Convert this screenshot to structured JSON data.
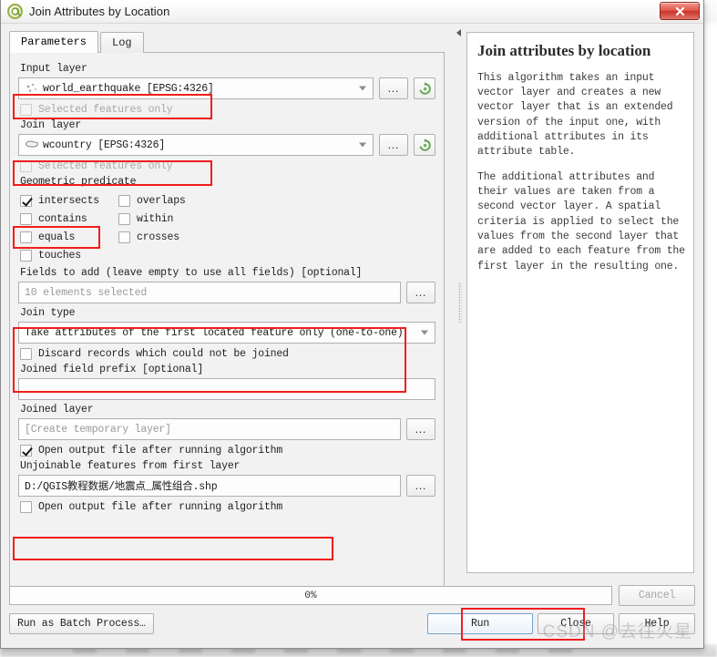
{
  "window": {
    "title": "Join Attributes by Location",
    "icon": "qgis-logo-icon",
    "close_label": "✕"
  },
  "tabs": [
    {
      "id": "parameters",
      "label": "Parameters",
      "active": true
    },
    {
      "id": "log",
      "label": "Log",
      "active": false
    }
  ],
  "form": {
    "input_layer": {
      "label": "Input layer",
      "value": "world_earthquake [EPSG:4326]",
      "icon": "point-layer-icon",
      "dots_label": "…",
      "iterate_icon": "iterate-over-features-icon",
      "highlighted": true
    },
    "input_selected_only": {
      "label": "Selected features only",
      "checked": false,
      "disabled": true
    },
    "join_layer": {
      "label": "Join layer",
      "value": "wcountry [EPSG:4326]",
      "icon": "polygon-layer-icon",
      "dots_label": "…",
      "iterate_icon": "iterate-over-features-icon",
      "highlighted": true
    },
    "join_selected_only": {
      "label": "Selected features only",
      "checked": false,
      "disabled": true
    },
    "geometric_predicate": {
      "label": "Geometric predicate",
      "options": [
        {
          "id": "intersects",
          "label": "intersects",
          "checked": true,
          "highlighted": true
        },
        {
          "id": "overlaps",
          "label": "overlaps",
          "checked": false,
          "highlighted": false
        },
        {
          "id": "contains",
          "label": "contains",
          "checked": false,
          "highlighted": false
        },
        {
          "id": "within",
          "label": "within",
          "checked": false,
          "highlighted": false
        },
        {
          "id": "equals",
          "label": "equals",
          "checked": false,
          "highlighted": false
        },
        {
          "id": "crosses",
          "label": "crosses",
          "checked": false,
          "highlighted": false
        },
        {
          "id": "touches",
          "label": "touches",
          "checked": false,
          "highlighted": false
        }
      ]
    },
    "fields_to_add": {
      "label": "Fields to add (leave empty to use all fields) [optional]",
      "value": "10 elements selected",
      "is_placeholder": true,
      "dots_label": "…"
    },
    "join_type": {
      "label": "Join type",
      "value": "Take attributes of the first located feature only (one-to-one)"
    },
    "discard_records": {
      "label": "Discard records which could not be joined",
      "checked": false
    },
    "joined_field_prefix": {
      "label": "Joined field prefix [optional]",
      "value": ""
    },
    "joined_layer": {
      "label": "Joined layer",
      "value": "[Create temporary layer]",
      "is_placeholder": true,
      "dots_label": "…"
    },
    "open_output_1": {
      "label": "Open output file after running algorithm",
      "checked": true
    },
    "unjoinable_features": {
      "label": "Unjoinable features from first layer",
      "value": "D:/QGIS教程数据/地震点_属性组合.shp",
      "dots_label": "…",
      "highlighted": true
    },
    "open_output_2": {
      "label": "Open output file after running algorithm",
      "checked": false
    }
  },
  "help": {
    "title": "Join attributes by location",
    "paragraphs": [
      "This algorithm takes an input vector layer and creates a new vector layer that is an extended version of the input one, with additional attributes in its attribute table.",
      "The additional attributes and their values are taken from a second vector layer. A spatial criteria is applied to select the values from the second layer that are added to each feature from the first layer in the resulting one."
    ]
  },
  "footer": {
    "progress_text": "0%",
    "progress_value": 0,
    "cancel_label": "Cancel",
    "batch_label": "Run as Batch Process…",
    "run_label": "Run",
    "close_label": "Close",
    "help_label": "Help",
    "run_highlighted": true
  },
  "watermark": "CSDN @去往火星",
  "colors": {
    "annotation": "#f21d1d",
    "dialog_bg": "#f0f0f0",
    "field_bg": "#fdfdfd",
    "accent_blue": "#6f9fd0",
    "close_red": "#c9342a"
  }
}
